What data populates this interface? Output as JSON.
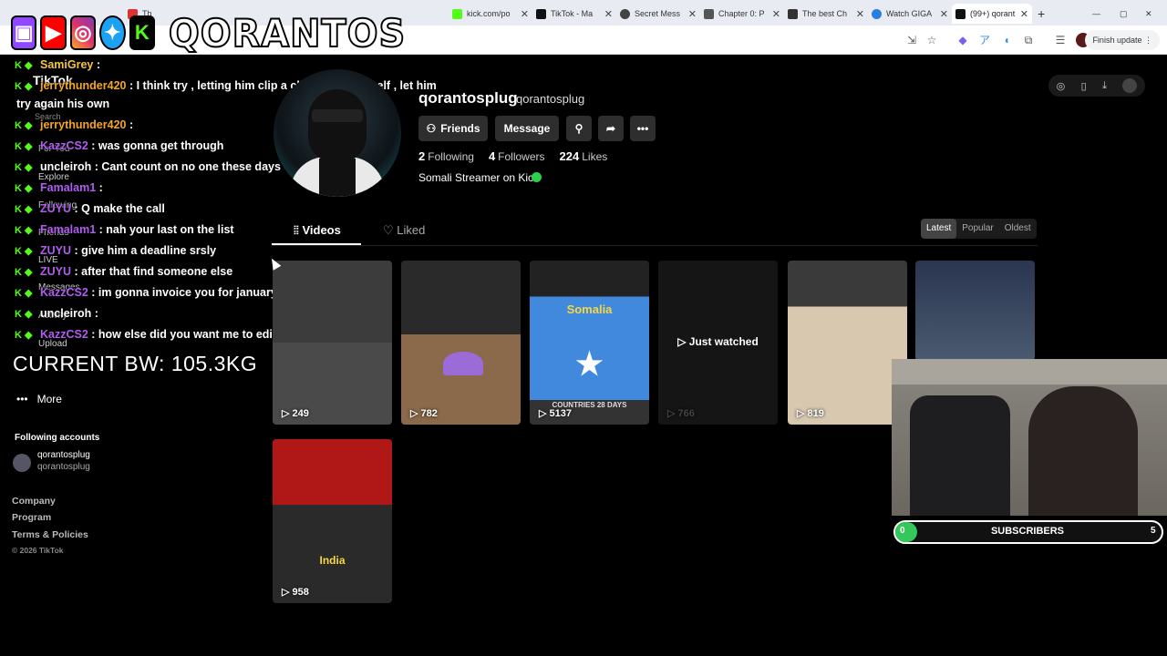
{
  "browser": {
    "tabs": [
      {
        "title": "Th",
        "color": "#d33"
      },
      {
        "title": "kick.com/po",
        "color": "#53fc18"
      },
      {
        "title": "TikTok - Ma",
        "color": "#111"
      },
      {
        "title": "Secret Mess",
        "color": "#444"
      },
      {
        "title": "Chapter 0: P",
        "color": "#555"
      },
      {
        "title": "The best Ch",
        "color": "#333"
      },
      {
        "title": "Watch GIGA",
        "color": "#2a7de1"
      },
      {
        "title": "(99+) qorant",
        "color": "#111"
      }
    ],
    "new_tab": "+",
    "finish_update": "Finish update"
  },
  "overlay": {
    "logo_text": "QORANTOS",
    "bw_text": "CURRENT BW: 105.3KG"
  },
  "chat": [
    {
      "user": "SamiGrey",
      "msg": "",
      "color": "#f5c542"
    },
    {
      "user": "jerrythunder420",
      "msg": "I think try , letting him clip a clip or two himself , let him",
      "color": "#f5a623"
    },
    {
      "user": "",
      "msg": "try again his own",
      "color": "#fff"
    },
    {
      "user": "jerrythunder420",
      "msg": "",
      "color": "#f5a623"
    },
    {
      "user": "KazzCS2",
      "msg": "was gonna get through",
      "color": "#b05cf0"
    },
    {
      "user": "uncleiroh",
      "msg": "Cant count on no one these days",
      "color": "#fff"
    },
    {
      "user": "Famalam1",
      "msg": "",
      "color": "#b05cf0"
    },
    {
      "user": "ZUYU",
      "msg": "Q make the call",
      "color": "#b05cf0"
    },
    {
      "user": "Famalam1",
      "msg": "nah your last on the list",
      "color": "#b05cf0"
    },
    {
      "user": "ZUYU",
      "msg": "give him a deadline srsly",
      "color": "#b05cf0"
    },
    {
      "user": "ZUYU",
      "msg": "after that find someone else",
      "color": "#b05cf0"
    },
    {
      "user": "KazzCS2",
      "msg": "im gonna invoice you for january",
      "color": "#b05cf0"
    },
    {
      "user": "uncleiroh",
      "msg": "",
      "color": "#fff"
    },
    {
      "user": "KazzCS2",
      "msg": "how else did you want me to edit that",
      "color": "#b05cf0"
    }
  ],
  "sidebar": {
    "brand": "TikTok",
    "search": "Search",
    "items": [
      "For You",
      "Explore",
      "Following",
      "Friends",
      "LIVE",
      "Messages",
      "Activity",
      "Upload"
    ],
    "more": "More",
    "following_title": "Following accounts",
    "account_name": "qorantosplug",
    "account_handle": "qorantosplug",
    "footer": [
      "Company",
      "Program",
      "Terms & Policies"
    ],
    "copyright": "© 2026 TikTok"
  },
  "profile": {
    "username": "qorantosplug",
    "handle": "qorantosplug",
    "friends_btn": "Friends",
    "message_btn": "Message",
    "following_count": "2",
    "following_label": "Following",
    "followers_count": "4",
    "followers_label": "Followers",
    "likes_count": "224",
    "likes_label": "Likes",
    "bio": "Somali Streamer on Kick"
  },
  "tabs": {
    "videos": "Videos",
    "liked": "Liked"
  },
  "sort": {
    "latest": "Latest",
    "popular": "Popular",
    "oldest": "Oldest"
  },
  "videos": [
    {
      "views": "249",
      "label": "",
      "bg": "#3a3a3a"
    },
    {
      "views": "782",
      "label": "",
      "bg": "#2c2c2c"
    },
    {
      "views": "5137",
      "label": "Somalia",
      "label2": "COUNTRIES 28 DAYS",
      "bg": "#4189dd"
    },
    {
      "views": "766",
      "label": "Just watched",
      "bg": "#1a1a1a"
    },
    {
      "views": "819",
      "label": "",
      "bg": "#c9b9a3"
    },
    {
      "views": "",
      "label": "",
      "bg": "#2a3550"
    },
    {
      "views": "958",
      "label": "India",
      "bg": "#8a1a1a"
    }
  ],
  "subs": {
    "current": "0",
    "label": "SUBSCRIBERS",
    "goal": "5",
    "progress": 0
  },
  "colors": {
    "kick_green": "#53fc18",
    "accent": "#fe2c55"
  }
}
